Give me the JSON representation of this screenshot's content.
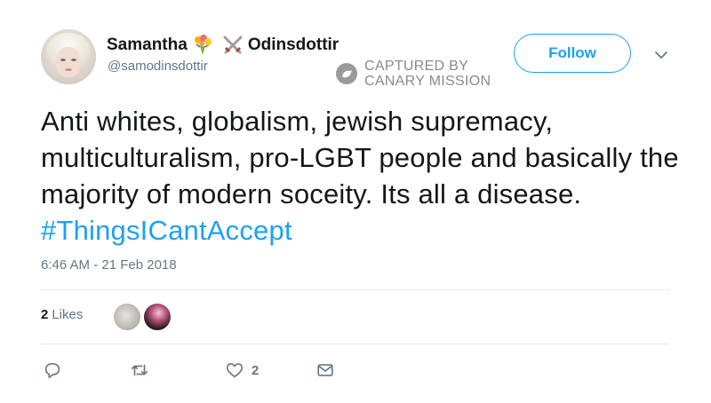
{
  "user": {
    "name_first": "Samantha",
    "name_last": "Odinsdottir",
    "handle": "@samodinsdottir",
    "name_emoji": [
      "bouquet-icon",
      "crossed-swords-icon"
    ]
  },
  "watermark": {
    "line1": "CAPTURED BY",
    "line2": "CANARY MISSION"
  },
  "follow_label": "Follow",
  "tweet": {
    "text": "Anti whites, globalism, jewish supremacy, multiculturalism, pro-LGBT people and basically the majority of modern soceity. Its all a disease.",
    "hashtag": "#ThingsICantAccept"
  },
  "timestamp": "6:46 AM - 21 Feb 2018",
  "likes": {
    "count": "2",
    "label": "Likes"
  },
  "actions": {
    "like_count": "2"
  },
  "colors": {
    "accent": "#1da1f2",
    "muted": "#657786",
    "text": "#14171a"
  }
}
